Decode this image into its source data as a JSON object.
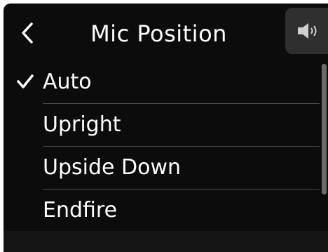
{
  "header": {
    "title": "Mic Position",
    "back_icon": "chevron-left-icon",
    "speaker_icon": "speaker-volume-icon"
  },
  "options": [
    {
      "label": "Auto",
      "selected": true
    },
    {
      "label": "Upright",
      "selected": false
    },
    {
      "label": "Upside Down",
      "selected": false
    },
    {
      "label": "Endfire",
      "selected": false
    }
  ],
  "colors": {
    "background": "#0c0c0c",
    "text": "#ffffff",
    "divider": "#4a4a4a",
    "tab": "#2f2f2f"
  }
}
